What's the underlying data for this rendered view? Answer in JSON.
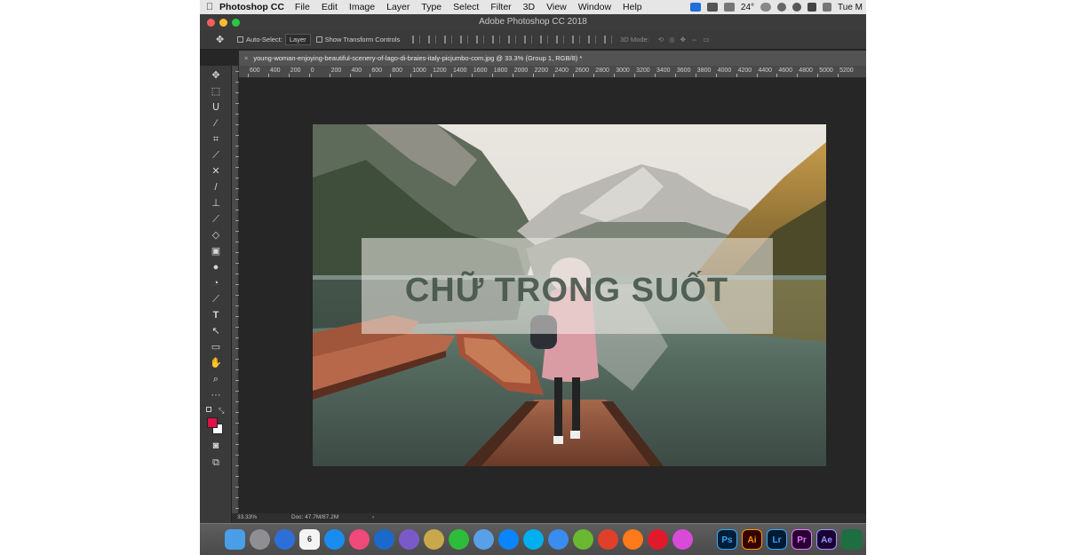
{
  "menubar": {
    "app_name": "Photoshop CC",
    "items": [
      "File",
      "Edit",
      "Image",
      "Layer",
      "Type",
      "Select",
      "Filter",
      "3D",
      "View",
      "Window",
      "Help"
    ],
    "temperature": "24°",
    "clock": "Tue M"
  },
  "window": {
    "title": "Adobe Photoshop CC 2018"
  },
  "options_bar": {
    "auto_select_label": "Auto-Select:",
    "auto_select_value": "Layer",
    "transform_label": "Show Transform Controls",
    "mode_3d": "3D Mode:"
  },
  "document": {
    "tab_title": "young-woman-enjoying-beautiful-scenery-of-lago-di-braies-italy-picjumbo-com.jpg @ 33.3% (Group 1, RGB/8) *",
    "overlay_text": "CHỮ TRONG SUỐT"
  },
  "ruler_top_labels": [
    "600",
    "400",
    "200",
    "0",
    "200",
    "400",
    "600",
    "800",
    "1000",
    "1200",
    "1400",
    "1600",
    "1800",
    "2000",
    "2200",
    "2400",
    "2600",
    "2800",
    "3000",
    "3200",
    "3400",
    "3600",
    "3800",
    "4000",
    "4200",
    "4400",
    "4600",
    "4800",
    "5000",
    "5200"
  ],
  "status": {
    "zoom": "33.33%",
    "doc_info": "Doc: 47.7M/87.2M",
    "arrow": "›"
  },
  "colors": {
    "foreground": "#e0104a",
    "background": "#ffffff",
    "ui_dark": "#262626",
    "panel": "#3a3a3a"
  },
  "tools": [
    "move-tool-icon",
    "marquee-tool-icon",
    "lasso-tool-icon",
    "magic-wand-icon",
    "crop-tool-icon",
    "eyedropper-icon",
    "healing-brush-icon",
    "brush-tool-icon",
    "clone-stamp-icon",
    "history-brush-icon",
    "eraser-icon",
    "gradient-icon",
    "blur-icon",
    "dodge-icon",
    "pen-tool-icon",
    "type-tool-icon",
    "path-selection-icon",
    "shape-tool-icon",
    "hand-tool-icon",
    "zoom-tool-icon",
    "more-tools-icon"
  ],
  "dock_labels": [
    "Ps",
    "Ai",
    "Lr",
    "Pr",
    "Ae"
  ]
}
